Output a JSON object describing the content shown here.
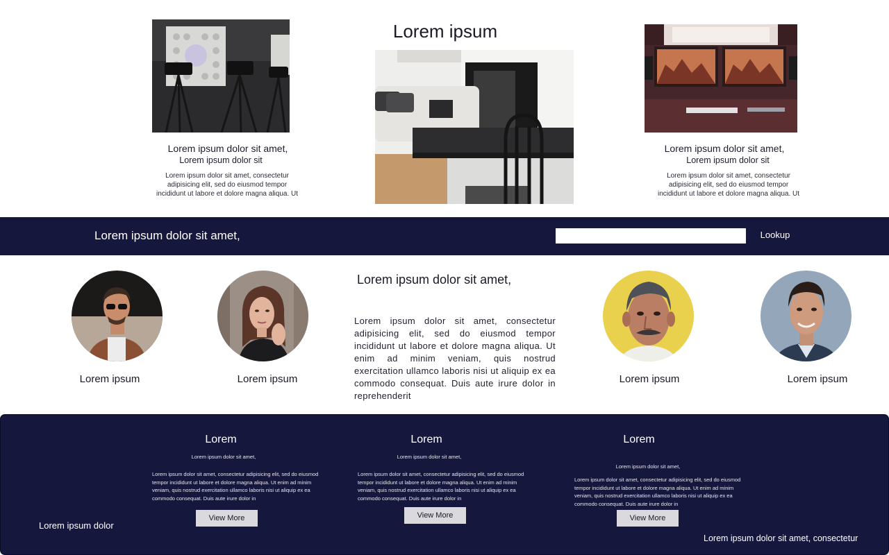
{
  "gallery": {
    "hero_title": "Lorem ipsum",
    "cards": [
      {
        "image_icon": "camera-studio-photo",
        "title": "Lorem ipsum dolor sit amet,",
        "subtitle": "Lorem ipsum dolor sit",
        "body": "Lorem ipsum dolor sit amet, consectetur adipisicing elit, sed do eiusmod tempor incididunt ut labore et dolore magna aliqua. Ut"
      },
      {
        "image_icon": "living-room-photo"
      },
      {
        "image_icon": "desk-monitors-photo",
        "title": "Lorem ipsum dolor sit amet,",
        "subtitle": "Lorem ipsum dolor sit",
        "body": "Lorem ipsum dolor sit amet, consectetur adipisicing elit, sed do eiusmod tempor incididunt ut labore et dolore magna aliqua. Ut"
      }
    ]
  },
  "search_band": {
    "title": "Lorem ipsum dolor sit amet,",
    "input_value": "",
    "button_label": "Lookup",
    "background_color": "#16173d"
  },
  "team": {
    "title": "Lorem ipsum dolor sit amet,",
    "body": "Lorem ipsum dolor sit amet, consectetur adipisicing elit, sed do eiusmod tempor incididunt ut labore et dolore magna aliqua. Ut enim ad minim veniam, quis nostrud exercitation ullamco laboris nisi ut aliquip ex ea commodo consequat. Duis aute irure dolor in reprehenderit",
    "members": [
      {
        "name": "Lorem ipsum",
        "photo_icon": "man-sunglasses-avatar"
      },
      {
        "name": "Lorem ipsum",
        "photo_icon": "woman-avatar"
      },
      {
        "name": "Lorem ipsum",
        "photo_icon": "elderly-man-avatar"
      },
      {
        "name": "Lorem ipsum",
        "photo_icon": "young-man-avatar"
      }
    ]
  },
  "footer": {
    "background_color": "#16173d",
    "left_text": "Lorem ipsum dolor",
    "right_text": "Lorem ipsum dolor sit amet, consectetur",
    "columns": [
      {
        "title": "Lorem",
        "subtitle": "Lorem ipsum dolor sit amet,",
        "body": "Lorem ipsum dolor sit amet, consectetur adipisicing elit, sed do eiusmod tempor incididunt ut labore et dolore magna aliqua. Ut enim ad minim veniam, quis nostrud exercitation ullamco laboris nisi ut aliquip ex ea commodo consequat. Duis aute irure dolor in",
        "button_label": "View More"
      },
      {
        "title": "Lorem",
        "subtitle": "Lorem ipsum dolor sit amet,",
        "body": "Lorem ipsum dolor sit amet, consectetur adipisicing elit, sed do eiusmod tempor incididunt ut labore et dolore magna aliqua. Ut enim ad minim veniam, quis nostrud exercitation ullamco laboris nisi ut aliquip ex ea commodo consequat. Duis aute irure dolor in",
        "button_label": "View More"
      },
      {
        "title": "Lorem",
        "subtitle": "Lorem ipsum dolor sit amet,",
        "body": "Lorem ipsum dolor sit amet, consectetur adipisicing elit, sed do eiusmod tempor incididunt ut labore et dolore magna aliqua. Ut enim ad minim veniam, quis nostrud exercitation ullamco laboris nisi ut aliquip ex ea commodo consequat. Duis aute irure dolor in",
        "button_label": "View More"
      }
    ]
  }
}
